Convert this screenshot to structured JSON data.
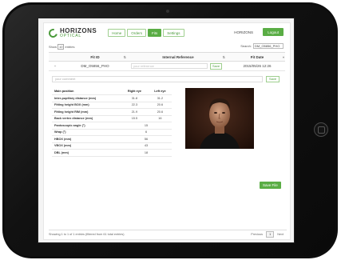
{
  "header": {
    "brand_name": "HORIZONS",
    "brand_sub": "OPTICAL",
    "nav": [
      {
        "label": "Home",
        "active": false
      },
      {
        "label": "Orders",
        "active": false
      },
      {
        "label": "Fits",
        "active": true
      },
      {
        "label": "Settings",
        "active": false
      }
    ],
    "user": "HORIZONS",
    "logout_label": "Logout"
  },
  "controls": {
    "show_prefix": "Show",
    "show_value": "10",
    "show_suffix": "entries",
    "search_label": "Search:",
    "search_value": "DM_O5856_PHO"
  },
  "table": {
    "columns": [
      "Fit ID",
      "Internal Reference",
      "Fit Date"
    ],
    "row": {
      "fit_id": "DM_O5856_PHO",
      "ref_placeholder": "your reference",
      "save_label": "Save",
      "fit_date": "2015/05/26 12:26"
    }
  },
  "detail": {
    "comment_placeholder": "your comment",
    "comment_save": "Save",
    "measure_header": "Main position",
    "right_header": "Right eye",
    "left_header": "Left eye",
    "measures": [
      {
        "label": "Inter-pupillary distance (mm)",
        "right": "31.8",
        "left": "31.2"
      },
      {
        "label": "Fitting height BOX (mm)",
        "right": "22.3",
        "left": "20.6"
      },
      {
        "label": "Fitting height RIM (mm)",
        "right": "21.9",
        "left": "20.6"
      },
      {
        "label": "Back vertex distance (mm)",
        "right": "15.5",
        "left": "16"
      }
    ],
    "merged": [
      {
        "label": "Pantoscopic angle (°)",
        "value": "15"
      },
      {
        "label": "Wrap (°)",
        "value": "6"
      },
      {
        "label": "HBOX (mm)",
        "value": "56"
      },
      {
        "label": "VBOX (mm)",
        "value": "43"
      },
      {
        "label": "DBL (mm)",
        "value": "18"
      }
    ],
    "save_file_label": "Save File"
  },
  "footer": {
    "showing": "Showing 1 to 1 of 1 entries (filtered from 61 total entries)",
    "previous": "Previous",
    "page": "1",
    "next": "Next"
  },
  "colors": {
    "accent": "#5aad45",
    "accent_light": "#9fcf8f"
  }
}
